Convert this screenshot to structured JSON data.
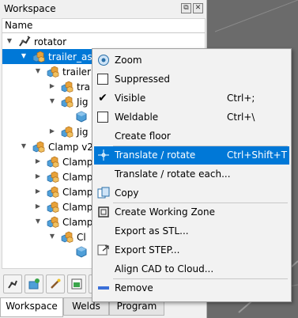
{
  "panel": {
    "title": "Workspace",
    "float_btn": "⧉",
    "close_btn": "✕",
    "column_header": "Name"
  },
  "tree": [
    {
      "label": "rotator",
      "icon": "robot-arm-icon",
      "expanded": true,
      "selected": false
    },
    {
      "label": "trailer_ass",
      "icon": "parts-group-icon",
      "expanded": true,
      "selected": true
    },
    {
      "label": "trailer",
      "icon": "parts-group-icon",
      "expanded": true,
      "selected": false
    },
    {
      "label": "tra",
      "icon": "parts-group-icon",
      "expanded": false,
      "selected": false
    },
    {
      "label": "Jig",
      "icon": "parts-group-icon",
      "expanded": true,
      "selected": false
    },
    {
      "label": "",
      "icon": "part-icon",
      "expanded": null,
      "selected": false
    },
    {
      "label": "Jig",
      "icon": "parts-group-icon",
      "expanded": false,
      "selected": false
    },
    {
      "label": "Clamp v2",
      "icon": "parts-group-icon",
      "expanded": true,
      "selected": false
    },
    {
      "label": "Clamp",
      "icon": "parts-group-icon",
      "expanded": false,
      "selected": false
    },
    {
      "label": "Clamp",
      "icon": "parts-group-icon",
      "expanded": false,
      "selected": false
    },
    {
      "label": "Clamp",
      "icon": "parts-group-icon",
      "expanded": false,
      "selected": false
    },
    {
      "label": "Clamp",
      "icon": "parts-group-icon",
      "expanded": false,
      "selected": false
    },
    {
      "label": "Clamp",
      "icon": "parts-group-icon",
      "expanded": true,
      "selected": false
    },
    {
      "label": "Cl",
      "icon": "parts-group-icon",
      "expanded": true,
      "selected": false
    },
    {
      "label": "",
      "icon": "part-icon",
      "expanded": null,
      "selected": false
    }
  ],
  "toolbar": [
    "robot-add-icon",
    "part-add-icon",
    "wand-icon",
    "cad-import-icon",
    "more-icon"
  ],
  "tabs": [
    {
      "label": "Workspace",
      "active": true
    },
    {
      "label": "Welds",
      "active": false
    },
    {
      "label": "Program",
      "active": false
    }
  ],
  "context_menu": {
    "items": [
      {
        "label": "Zoom",
        "shortcut": "",
        "icon": "zoom-icon",
        "check": null
      },
      {
        "label": "Suppressed",
        "shortcut": "",
        "icon": null,
        "check": false
      },
      {
        "label": "Visible",
        "shortcut": "Ctrl+;",
        "icon": null,
        "check": true
      },
      {
        "label": "Weldable",
        "shortcut": "Ctrl+\\",
        "icon": null,
        "check": false
      },
      {
        "label": "Create floor",
        "shortcut": "",
        "icon": null,
        "check": null
      },
      {
        "label": "Translate / rotate",
        "shortcut": "Ctrl+Shift+T",
        "icon": "move-icon",
        "check": null,
        "highlighted": true
      },
      {
        "label": "Translate / rotate each...",
        "shortcut": "",
        "icon": null,
        "check": null
      },
      {
        "label": "Copy",
        "shortcut": "",
        "icon": "copy-icon",
        "check": null
      },
      {
        "label": "Create Working Zone",
        "shortcut": "",
        "icon": "working-zone-icon",
        "check": null
      },
      {
        "label": "Export as STL...",
        "shortcut": "",
        "icon": null,
        "check": null
      },
      {
        "label": "Export STEP...",
        "shortcut": "",
        "icon": "export-step-icon",
        "check": null
      },
      {
        "label": "Align CAD to Cloud...",
        "shortcut": "",
        "icon": null,
        "check": null
      },
      {
        "label": "Remove",
        "shortcut": "",
        "icon": "remove-icon",
        "check": null
      }
    ]
  },
  "colors": {
    "selection": "#0078d7",
    "viewport_bg": "#6b6b6b",
    "part_orange": "#e8a23a",
    "part_blue": "#4f9fd8"
  }
}
